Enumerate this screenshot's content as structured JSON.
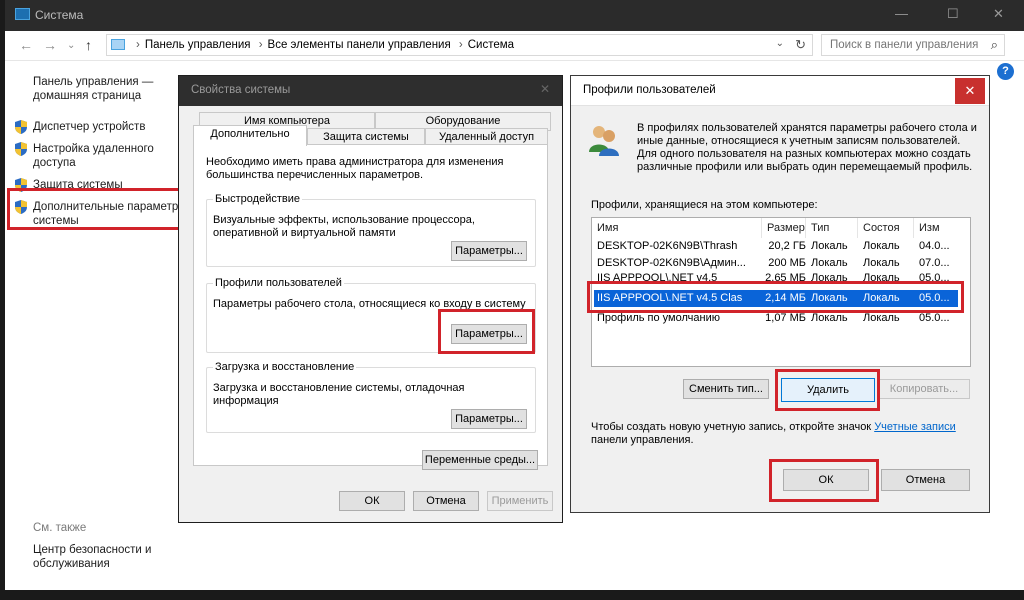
{
  "window": {
    "title": "Система",
    "minimize": "—",
    "maximize": "☐",
    "close": "✕"
  },
  "address": {
    "crumbs": [
      "Панель управления",
      "Все элементы панели управления",
      "Система"
    ],
    "search_placeholder": "Поиск в панели управления"
  },
  "sidebar": {
    "home": "Панель управления — домашняя страница",
    "items": [
      {
        "label": "Диспетчер устройств"
      },
      {
        "label": "Настройка удаленного доступа"
      },
      {
        "label": "Защита системы"
      },
      {
        "label": "Дополнительные параметры системы"
      }
    ],
    "see_also": "См. также",
    "see_also_item": "Центр безопасности и обслуживания"
  },
  "sysprops": {
    "title": "Свойства системы",
    "tabs_row1": [
      "Имя компьютера",
      "Оборудование"
    ],
    "tabs_row2": [
      "Дополнительно",
      "Защита системы",
      "Удаленный доступ"
    ],
    "note": "Необходимо иметь права администратора для изменения большинства перечисленных параметров.",
    "groups": [
      {
        "title": "Быстродействие",
        "desc": "Визуальные эффекты, использование процессора, оперативной и виртуальной памяти",
        "button": "Параметры..."
      },
      {
        "title": "Профили пользователей",
        "desc": "Параметры рабочего стола, относящиеся ко входу в систему",
        "button": "Параметры..."
      },
      {
        "title": "Загрузка и восстановление",
        "desc": "Загрузка и восстановление системы, отладочная информация",
        "button": "Параметры..."
      }
    ],
    "env_button": "Переменные среды...",
    "ok": "ОК",
    "cancel": "Отмена",
    "apply": "Применить"
  },
  "profiles": {
    "title": "Профили пользователей",
    "intro": "В профилях пользователей хранятся параметры рабочего стола и иные данные, относящиеся к учетным записям пользователей. Для одного пользователя на разных компьютерах можно создать различные профили или выбрать один перемещаемый профиль.",
    "list_label": "Профили, хранящиеся на этом компьютере:",
    "columns": [
      "Имя",
      "Размер",
      "Тип",
      "Состоя",
      "Изм"
    ],
    "rows": [
      {
        "name": "DESKTOP-02K6N9B\\Thrash",
        "size": "20,2 ГБ",
        "type": "Локаль",
        "state": "Локаль",
        "mod": "04.0..."
      },
      {
        "name": "DESKTOP-02K6N9B\\Админ...",
        "size": "200 МБ",
        "type": "Локаль",
        "state": "Локаль",
        "mod": "07.0..."
      },
      {
        "name": "IIS APPPOOL\\.NET v4.5",
        "size": "2,65 МБ",
        "type": "Локаль",
        "state": "Локаль",
        "mod": "05.0..."
      },
      {
        "name": "IIS APPPOOL\\.NET v4.5 Clas",
        "size": "2,14 МБ",
        "type": "Локаль",
        "state": "Локаль",
        "mod": "05.0..."
      },
      {
        "name": "Профиль по умолчанию",
        "size": "1,07 МБ",
        "type": "Локаль",
        "state": "Локаль",
        "mod": "05.0..."
      }
    ],
    "change_type": "Сменить тип...",
    "delete": "Удалить",
    "copy": "Копировать...",
    "footer_text": "Чтобы создать новую учетную запись, откройте значок",
    "footer_link": "Учетные записи",
    "footer_end": "панели управления.",
    "ok": "ОК",
    "cancel": "Отмена"
  },
  "colors": {
    "highlight": "#d1232a",
    "selection": "#0a64d8",
    "link": "#0066cc"
  }
}
